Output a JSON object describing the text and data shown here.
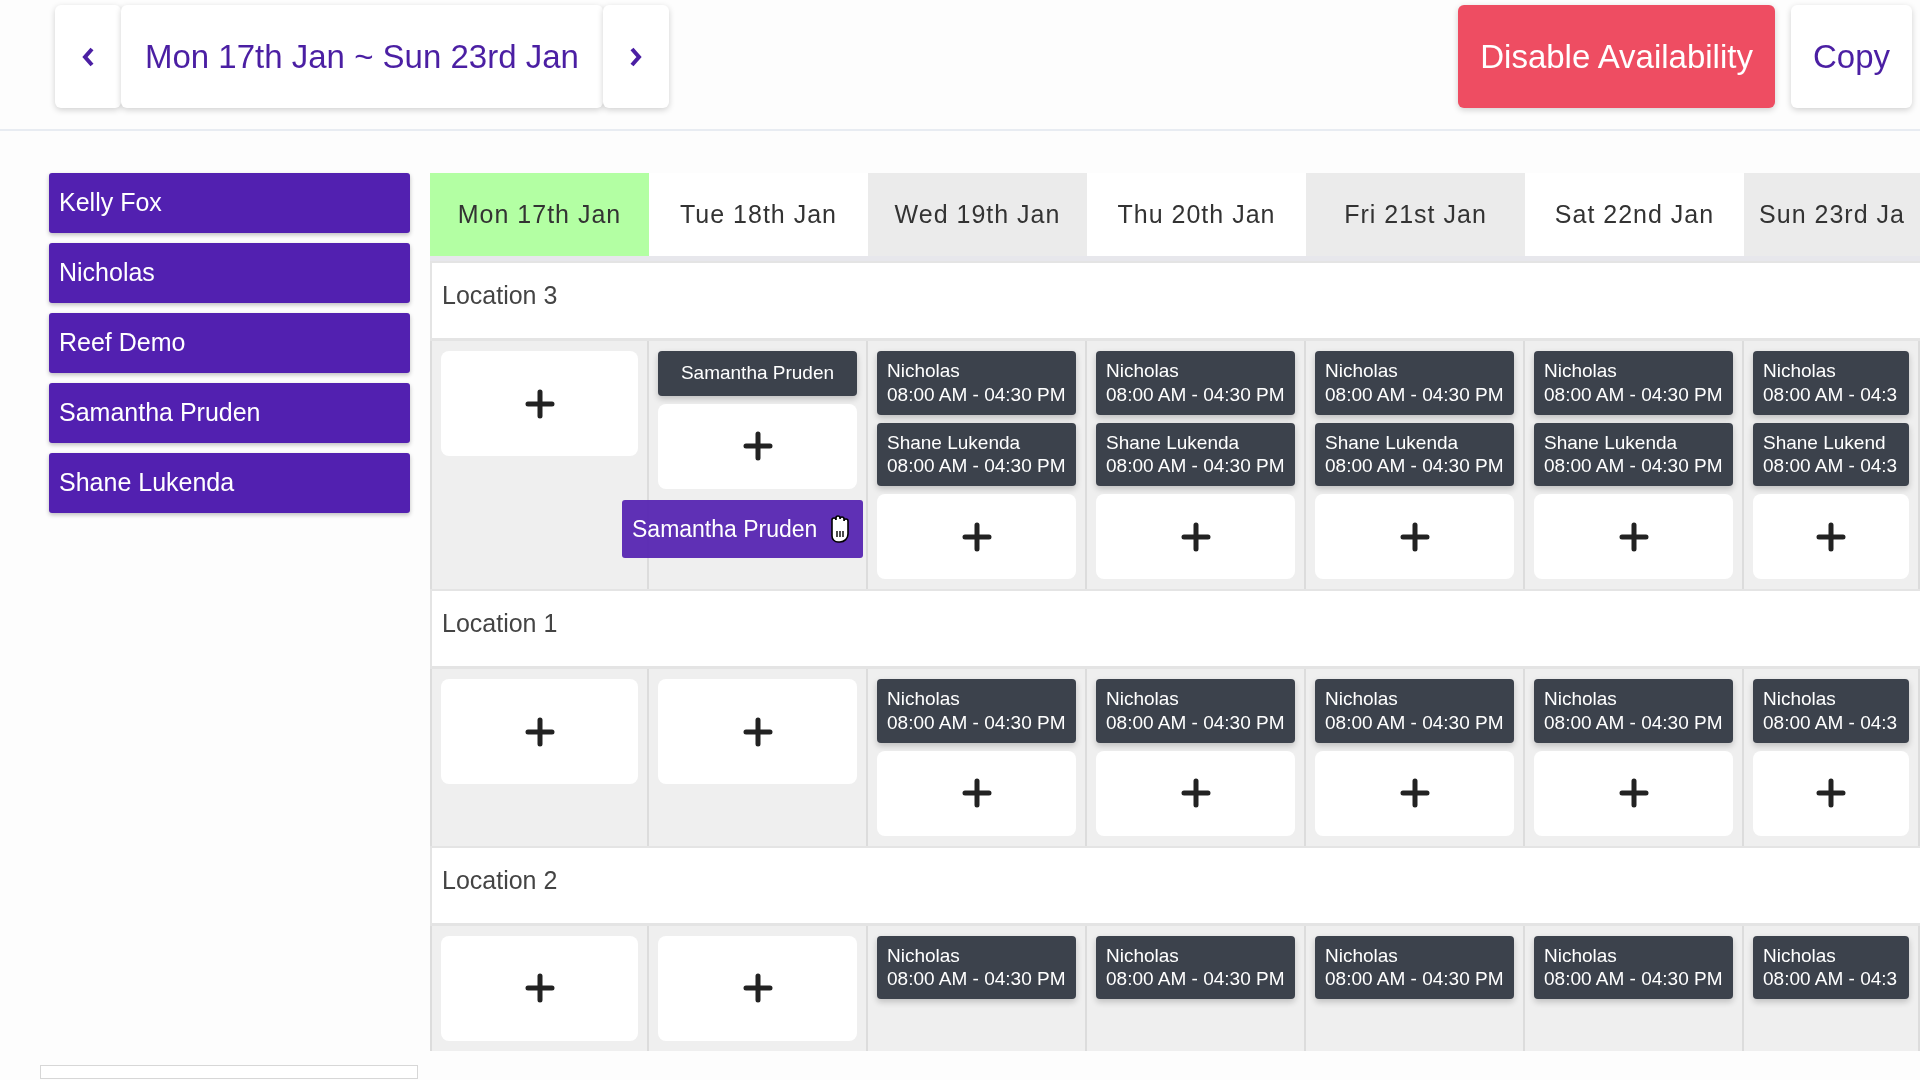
{
  "toolbar": {
    "date_range": "Mon 17th Jan ~ Sun 23rd Jan",
    "actions": [
      {
        "label": "Disable Availability",
        "kind": "danger"
      },
      {
        "label": "Copy",
        "kind": "light"
      }
    ]
  },
  "staff": [
    "Kelly Fox",
    "Nicholas",
    "Reef Demo",
    "Samantha Pruden",
    "Shane Lukenda"
  ],
  "days": [
    {
      "label": "Mon 17th Jan",
      "selected": true
    },
    {
      "label": "Tue 18th Jan",
      "selected": false
    },
    {
      "label": "Wed 19th Jan",
      "selected": false
    },
    {
      "label": "Thu 20th Jan",
      "selected": false
    },
    {
      "label": "Fri 21st Jan",
      "selected": false
    },
    {
      "label": "Sat 22nd Jan",
      "selected": false
    },
    {
      "label": "Sun 23rd Ja",
      "selected": false
    }
  ],
  "locations": [
    {
      "name": "Location 3",
      "cells": [
        {
          "add": true
        },
        {
          "items": [
            {
              "kind": "staff",
              "name": "Samantha Pruden"
            }
          ],
          "add": true
        },
        {
          "items": [
            {
              "kind": "shift",
              "name": "Nicholas",
              "time": "08:00 AM - 04:30 PM"
            },
            {
              "kind": "shift",
              "name": "Shane Lukenda",
              "time": "08:00 AM - 04:30 PM"
            }
          ],
          "add": true
        },
        {
          "items": [
            {
              "kind": "shift",
              "name": "Nicholas",
              "time": "08:00 AM - 04:30 PM"
            },
            {
              "kind": "shift",
              "name": "Shane Lukenda",
              "time": "08:00 AM - 04:30 PM"
            }
          ],
          "add": true
        },
        {
          "items": [
            {
              "kind": "shift",
              "name": "Nicholas",
              "time": "08:00 AM - 04:30 PM"
            },
            {
              "kind": "shift",
              "name": "Shane Lukenda",
              "time": "08:00 AM - 04:30 PM"
            }
          ],
          "add": true
        },
        {
          "items": [
            {
              "kind": "shift",
              "name": "Nicholas",
              "time": "08:00 AM - 04:30 PM"
            },
            {
              "kind": "shift",
              "name": "Shane Lukenda",
              "time": "08:00 AM - 04:30 PM"
            }
          ],
          "add": true
        },
        {
          "items": [
            {
              "kind": "shift",
              "name": "Nicholas",
              "time": "08:00 AM - 04:3"
            },
            {
              "kind": "shift",
              "name": "Shane Lukend",
              "time": "08:00 AM - 04:3"
            }
          ],
          "add": true
        }
      ]
    },
    {
      "name": "Location 1",
      "cells": [
        {
          "add": true
        },
        {
          "add": true
        },
        {
          "items": [
            {
              "kind": "shift",
              "name": "Nicholas",
              "time": "08:00 AM - 04:30 PM"
            }
          ],
          "add": true
        },
        {
          "items": [
            {
              "kind": "shift",
              "name": "Nicholas",
              "time": "08:00 AM - 04:30 PM"
            }
          ],
          "add": true
        },
        {
          "items": [
            {
              "kind": "shift",
              "name": "Nicholas",
              "time": "08:00 AM - 04:30 PM"
            }
          ],
          "add": true
        },
        {
          "items": [
            {
              "kind": "shift",
              "name": "Nicholas",
              "time": "08:00 AM - 04:30 PM"
            }
          ],
          "add": true
        },
        {
          "items": [
            {
              "kind": "shift",
              "name": "Nicholas",
              "time": "08:00 AM - 04:3"
            }
          ],
          "add": true
        }
      ]
    },
    {
      "name": "Location 2",
      "cells": [
        {
          "add": true
        },
        {
          "add": true
        },
        {
          "items": [
            {
              "kind": "shift",
              "name": "Nicholas",
              "time": "08:00 AM - 04:30 PM"
            }
          ],
          "add": false
        },
        {
          "items": [
            {
              "kind": "shift",
              "name": "Nicholas",
              "time": "08:00 AM - 04:30 PM"
            }
          ],
          "add": false
        },
        {
          "items": [
            {
              "kind": "shift",
              "name": "Nicholas",
              "time": "08:00 AM - 04:30 PM"
            }
          ],
          "add": false
        },
        {
          "items": [
            {
              "kind": "shift",
              "name": "Nicholas",
              "time": "08:00 AM - 04:30 PM"
            }
          ],
          "add": false
        },
        {
          "items": [
            {
              "kind": "shift",
              "name": "Nicholas",
              "time": "08:00 AM - 04:3"
            }
          ],
          "add": false
        }
      ]
    }
  ],
  "drag_ghost": {
    "name": "Samantha Pruden"
  }
}
